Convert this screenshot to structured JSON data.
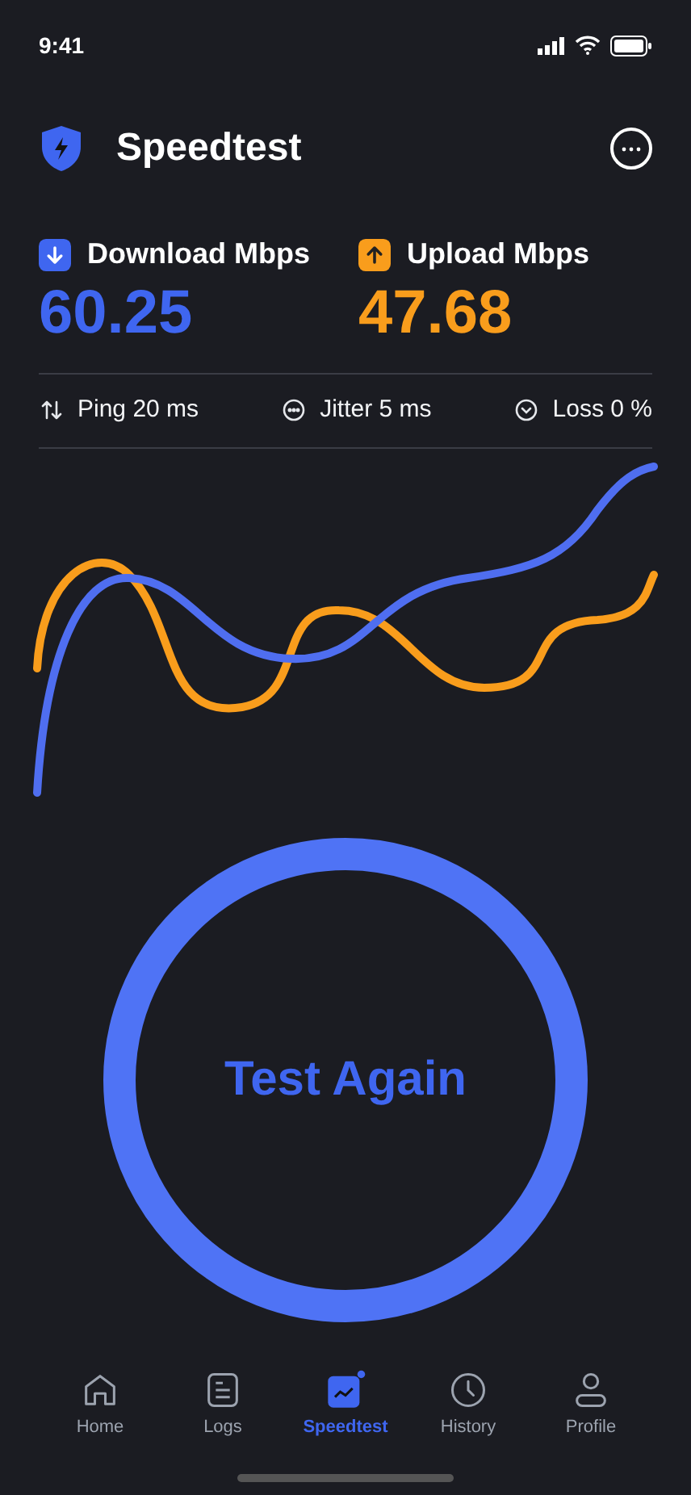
{
  "status_bar": {
    "time": "9:41"
  },
  "header": {
    "title": "Speedtest"
  },
  "metrics": [
    {
      "kind": "download",
      "label": "Download Mbps",
      "value": "60.25",
      "color": "#3f66f0"
    },
    {
      "kind": "upload",
      "label": "Upload Mbps",
      "value": "47.68",
      "color": "#f99d1c"
    }
  ],
  "stats": [
    {
      "kind": "ping",
      "label": "Ping 20 ms"
    },
    {
      "kind": "jitter",
      "label": "Jitter 5 ms"
    },
    {
      "kind": "loss",
      "label": "Loss 0 %"
    }
  ],
  "action": {
    "label": "Test Again"
  },
  "nav": [
    {
      "kind": "home",
      "label": "Home",
      "selected": false
    },
    {
      "kind": "logs",
      "label": "Logs",
      "selected": false
    },
    {
      "kind": "speedtest",
      "label": "Speedtest",
      "selected": true
    },
    {
      "kind": "history",
      "label": "History",
      "selected": false
    },
    {
      "kind": "profile",
      "label": "Profile",
      "selected": false
    }
  ]
}
